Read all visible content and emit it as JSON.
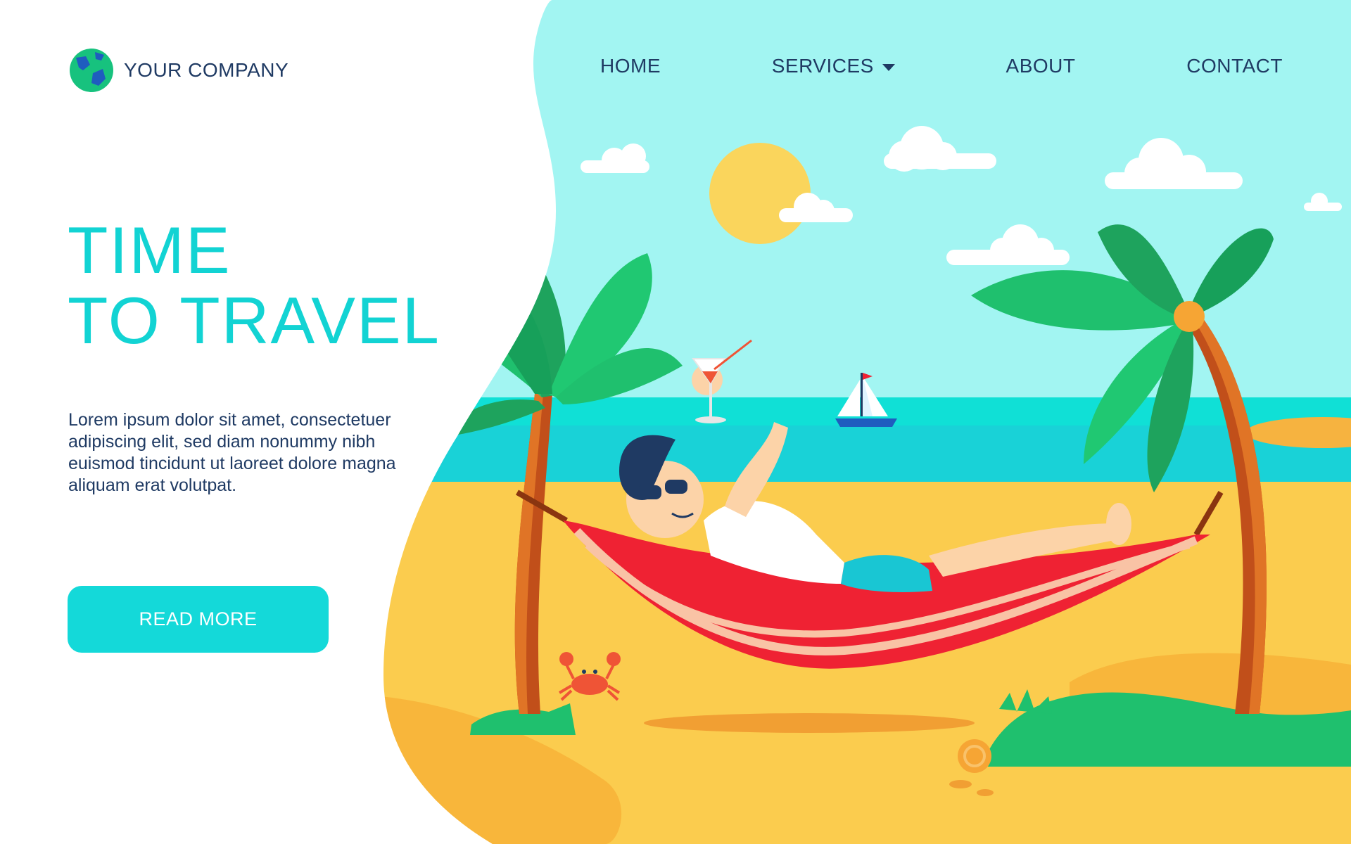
{
  "header": {
    "company_name": "YOUR COMPANY",
    "logo_icon": "globe-icon"
  },
  "nav": {
    "items": [
      {
        "label": "HOME"
      },
      {
        "label": "SERVICES",
        "has_dropdown": true
      },
      {
        "label": "ABOUT"
      },
      {
        "label": "CONTACT"
      }
    ]
  },
  "hero": {
    "title_line1": "TIME",
    "title_line2": "TO TRAVEL",
    "body": "Lorem ipsum dolor sit amet, consectetuer adipiscing elit, sed diam nonummy nibh euismod tincidunt ut laoreet dolore magna aliquam erat volutpat.",
    "cta_label": "READ MORE"
  },
  "colors": {
    "accent": "#14d9d9",
    "text_dark": "#1f3a63",
    "sky": "#a2f5f2",
    "sea": "#10e0d6",
    "sand": "#fbcc4e",
    "palm_leaf": "#1fc06e",
    "hammock_red": "#ef2233"
  }
}
